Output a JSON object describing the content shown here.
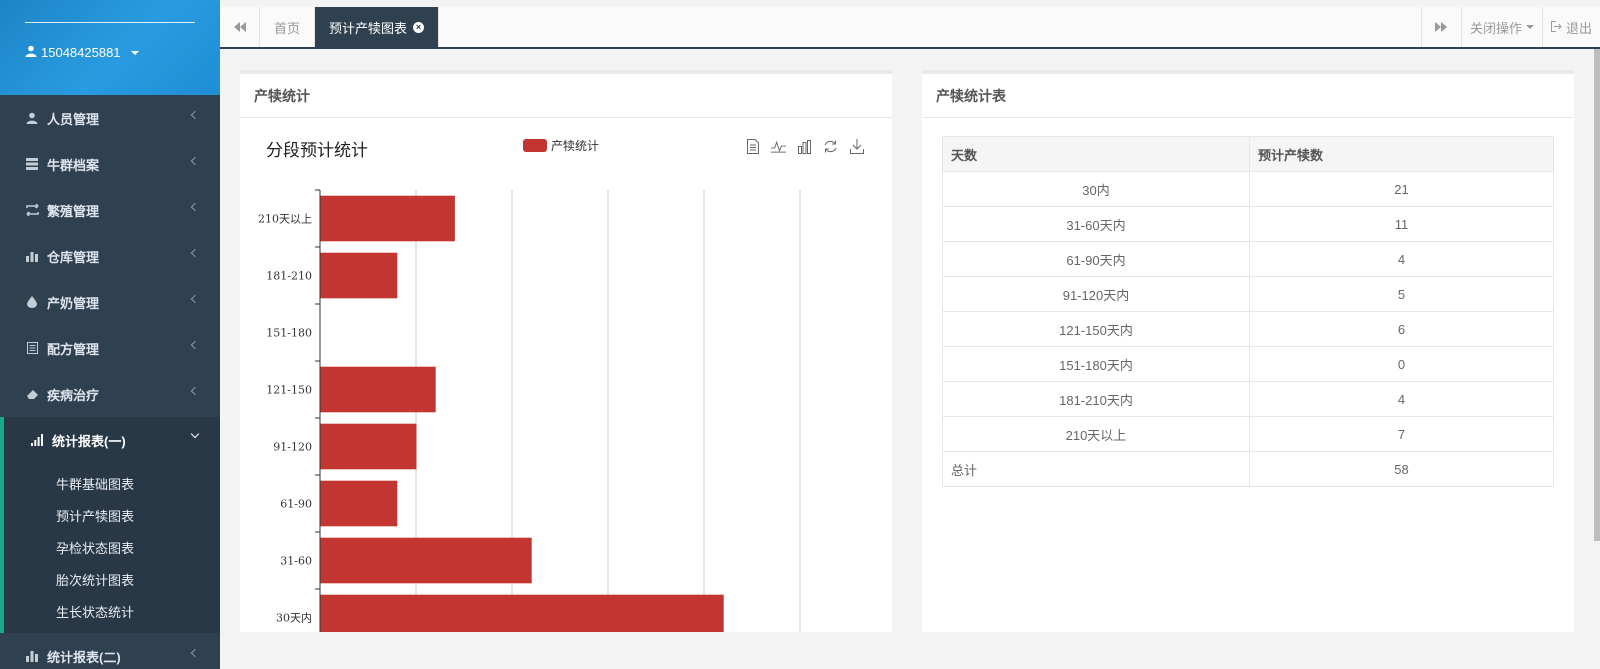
{
  "user": {
    "phone": "15048425881"
  },
  "sidebar": {
    "items": [
      {
        "label": "人员管理",
        "icon": "user-icon"
      },
      {
        "label": "牛群档案",
        "icon": "server-icon"
      },
      {
        "label": "繁殖管理",
        "icon": "retweet-icon"
      },
      {
        "label": "仓库管理",
        "icon": "building-icon"
      },
      {
        "label": "产奶管理",
        "icon": "tint-icon"
      },
      {
        "label": "配方管理",
        "icon": "list-icon"
      },
      {
        "label": "疾病治疗",
        "icon": "eraser-icon"
      }
    ],
    "active": {
      "label": "统计报表(一)",
      "icon": "signal-icon"
    },
    "subitems": [
      "牛群基础图表",
      "预计产犊图表",
      "孕检状态图表",
      "胎次统计图表",
      "生长状态统计"
    ],
    "next": {
      "label": "统计报表(二)",
      "icon": "bar-chart-icon"
    }
  },
  "tabs": {
    "home": "首页",
    "active": "预计产犊图表"
  },
  "topbar": {
    "close_ops": "关闭操作",
    "logout": "退出"
  },
  "left_panel": {
    "title": "产犊统计"
  },
  "right_panel": {
    "title": "产犊统计表"
  },
  "chart_data": {
    "type": "bar",
    "orientation": "horizontal",
    "title": "分段预计统计",
    "legend": [
      "产犊统计"
    ],
    "categories": [
      "30天内",
      "31-60",
      "61-90",
      "91-120",
      "121-150",
      "151-180",
      "181-210",
      "210天以上"
    ],
    "series": [
      {
        "name": "产犊统计",
        "values": [
          21,
          11,
          4,
          5,
          6,
          0,
          4,
          7
        ]
      }
    ],
    "xlim": [
      0,
      25
    ],
    "xticks": [
      0,
      5,
      10,
      15,
      20,
      25
    ],
    "grid": true,
    "color": "#c23531"
  },
  "table": {
    "headers": [
      "天数",
      "预计产犊数"
    ],
    "rows": [
      [
        "30内",
        "21"
      ],
      [
        "31-60天内",
        "11"
      ],
      [
        "61-90天内",
        "4"
      ],
      [
        "91-120天内",
        "5"
      ],
      [
        "121-150天内",
        "6"
      ],
      [
        "151-180天内",
        "0"
      ],
      [
        "181-210天内",
        "4"
      ],
      [
        "210天以上",
        "7"
      ]
    ],
    "total_label": "总计",
    "total_value": "58"
  }
}
